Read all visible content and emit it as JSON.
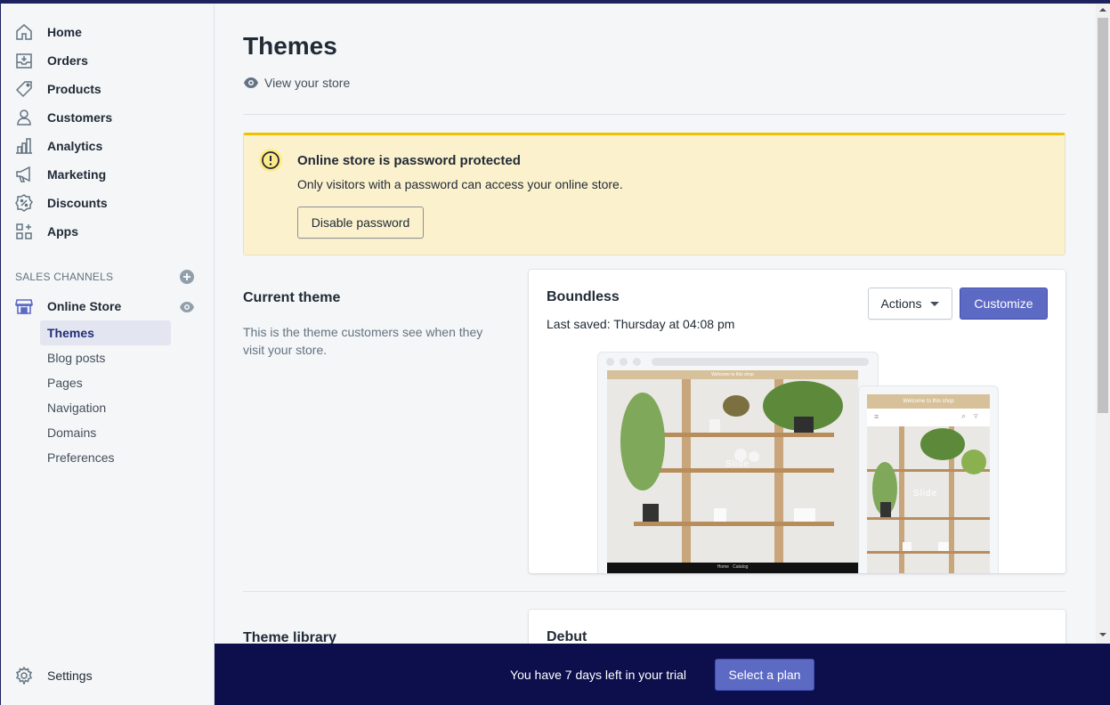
{
  "sidebar": {
    "items": [
      {
        "label": "Home",
        "icon": "home-icon"
      },
      {
        "label": "Orders",
        "icon": "orders-icon"
      },
      {
        "label": "Products",
        "icon": "tag-icon"
      },
      {
        "label": "Customers",
        "icon": "person-icon"
      },
      {
        "label": "Analytics",
        "icon": "bar-chart-icon"
      },
      {
        "label": "Marketing",
        "icon": "megaphone-icon"
      },
      {
        "label": "Discounts",
        "icon": "discount-icon"
      },
      {
        "label": "Apps",
        "icon": "apps-icon"
      }
    ],
    "sales_channels_heading": "SALES CHANNELS",
    "online_store_label": "Online Store",
    "sub_items": [
      "Themes",
      "Blog posts",
      "Pages",
      "Navigation",
      "Domains",
      "Preferences"
    ],
    "active_sub_item": "Themes",
    "settings_label": "Settings"
  },
  "main": {
    "title": "Themes",
    "view_store": "View your store",
    "banner": {
      "title": "Online store is password protected",
      "text": "Only visitors with a password can access your online store.",
      "button": "Disable password"
    },
    "current_theme": {
      "heading": "Current theme",
      "description": "This is the theme customers see when they visit your store.",
      "name": "Boundless",
      "last_saved": "Last saved: Thursday at 04:08 pm",
      "actions_label": "Actions",
      "customize_label": "Customize",
      "preview": {
        "desktop_banner": "Welcome to this shop",
        "mobile_banner": "Welcome to this shop",
        "slide_label": "Slide",
        "footer_links": [
          "Home",
          "Catalog"
        ]
      }
    },
    "theme_library": {
      "heading": "Theme library",
      "card_title": "Debut"
    }
  },
  "trial": {
    "text": "You have 7 days left in your trial",
    "button": "Select a plan"
  },
  "colors": {
    "accent": "#5c6ac4",
    "banner_bg": "#fcf1cd",
    "banner_border": "#eec200",
    "trial_bg": "#0c0f4c"
  }
}
